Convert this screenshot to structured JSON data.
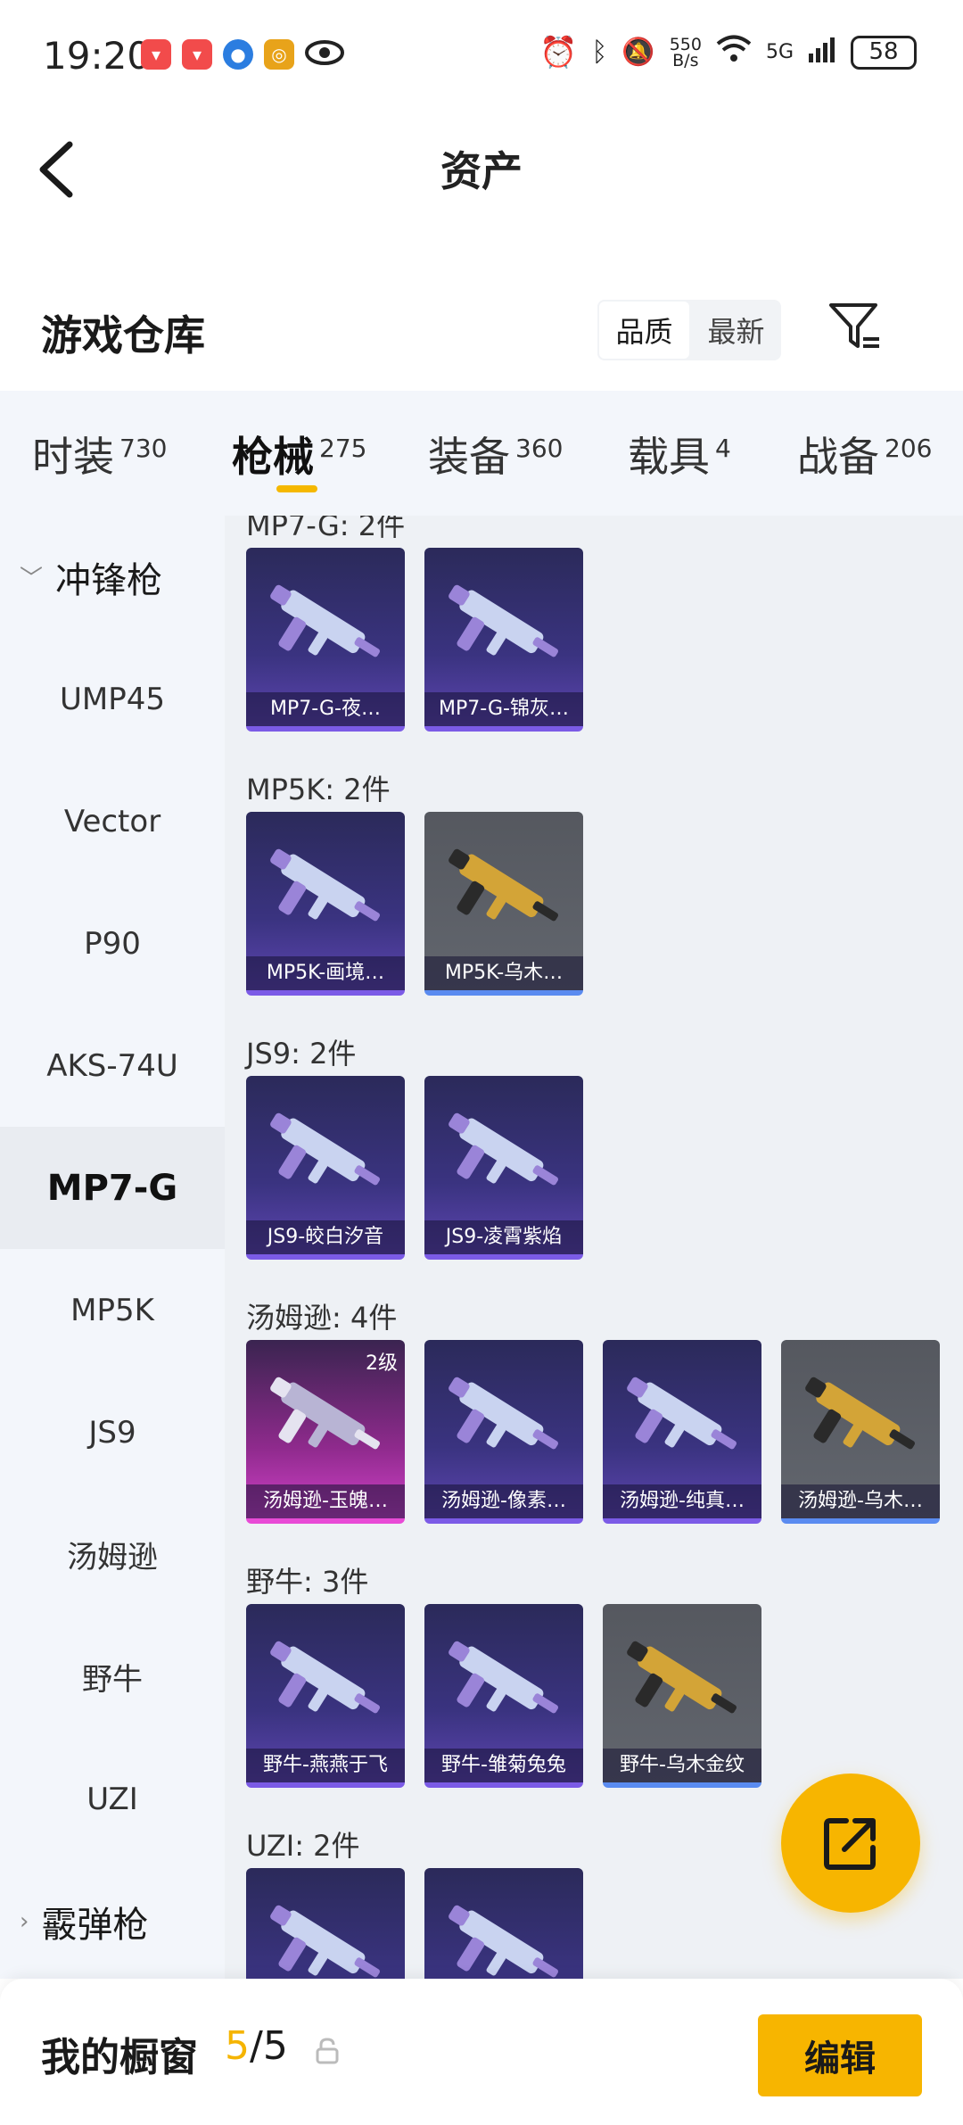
{
  "status_bar": {
    "time": "19:20",
    "net_speed_value": "550",
    "net_speed_unit": "B/s",
    "network": "5G",
    "battery": "58",
    "app_icons": [
      "red-app-icon",
      "red-app-icon",
      "globe-app-icon",
      "orange-app-icon",
      "eye-icon"
    ],
    "sys_icons": [
      "alarm-icon",
      "bluetooth-icon",
      "mute-icon",
      "wifi-icon",
      "signal-icon"
    ]
  },
  "header": {
    "title": "资产"
  },
  "warehouse": {
    "title": "游戏仓库",
    "sort_options": [
      {
        "label": "品质",
        "active": true
      },
      {
        "label": "最新",
        "active": false
      }
    ]
  },
  "category_tabs": [
    {
      "label": "时装",
      "count": "730",
      "active": false
    },
    {
      "label": "枪械",
      "count": "275",
      "active": true
    },
    {
      "label": "装备",
      "count": "360",
      "active": false
    },
    {
      "label": "载具",
      "count": "4",
      "active": false
    },
    {
      "label": "战备",
      "count": "206",
      "active": false
    }
  ],
  "sidebar": {
    "items": [
      {
        "label": "冲锋枪",
        "type": "group",
        "expanded": true
      },
      {
        "label": "UMP45"
      },
      {
        "label": "Vector"
      },
      {
        "label": "P90"
      },
      {
        "label": "AKS-74U"
      },
      {
        "label": "MP7-G",
        "selected": true
      },
      {
        "label": "MP5K"
      },
      {
        "label": "JS9"
      },
      {
        "label": "汤姆逊"
      },
      {
        "label": "野牛"
      },
      {
        "label": "UZI"
      },
      {
        "label": "霰弹枪",
        "type": "group",
        "expanded": false
      }
    ]
  },
  "groups": [
    {
      "label": "MP7-G: 2件",
      "items": [
        {
          "name": "MP7-G-夜…",
          "rarity": "purple"
        },
        {
          "name": "MP7-G-锦灰…",
          "rarity": "purple"
        }
      ]
    },
    {
      "label": "MP5K: 2件",
      "items": [
        {
          "name": "MP5K-画境…",
          "rarity": "purple"
        },
        {
          "name": "MP5K-乌木…",
          "rarity": "gray"
        }
      ]
    },
    {
      "label": "JS9: 2件",
      "items": [
        {
          "name": "JS9-皎白汐音",
          "rarity": "purple"
        },
        {
          "name": "JS9-凌霄紫焰",
          "rarity": "purple"
        }
      ]
    },
    {
      "label": "汤姆逊: 4件",
      "items": [
        {
          "name": "汤姆逊-玉魄…",
          "rarity": "pink",
          "level": "2级"
        },
        {
          "name": "汤姆逊-像素…",
          "rarity": "purple"
        },
        {
          "name": "汤姆逊-纯真…",
          "rarity": "purple"
        },
        {
          "name": "汤姆逊-乌木…",
          "rarity": "gray"
        }
      ]
    },
    {
      "label": "野牛: 3件",
      "items": [
        {
          "name": "野牛-燕燕于飞",
          "rarity": "purple"
        },
        {
          "name": "野牛-雏菊兔兔",
          "rarity": "purple"
        },
        {
          "name": "野牛-乌木金纹",
          "rarity": "gray"
        }
      ]
    },
    {
      "label": "UZI: 2件",
      "items": [
        {
          "name": "",
          "rarity": "purple"
        },
        {
          "name": "",
          "rarity": "purple"
        }
      ]
    }
  ],
  "showcase": {
    "label": "我的橱窗",
    "current": "5",
    "separator": "/",
    "total": "5",
    "edit_label": "编辑"
  },
  "colors": {
    "accent": "#f7b500",
    "purple_rarity": "#7b5be6",
    "gray_rarity": "#5a8bf0",
    "pink_rarity": "#e84bd6"
  }
}
